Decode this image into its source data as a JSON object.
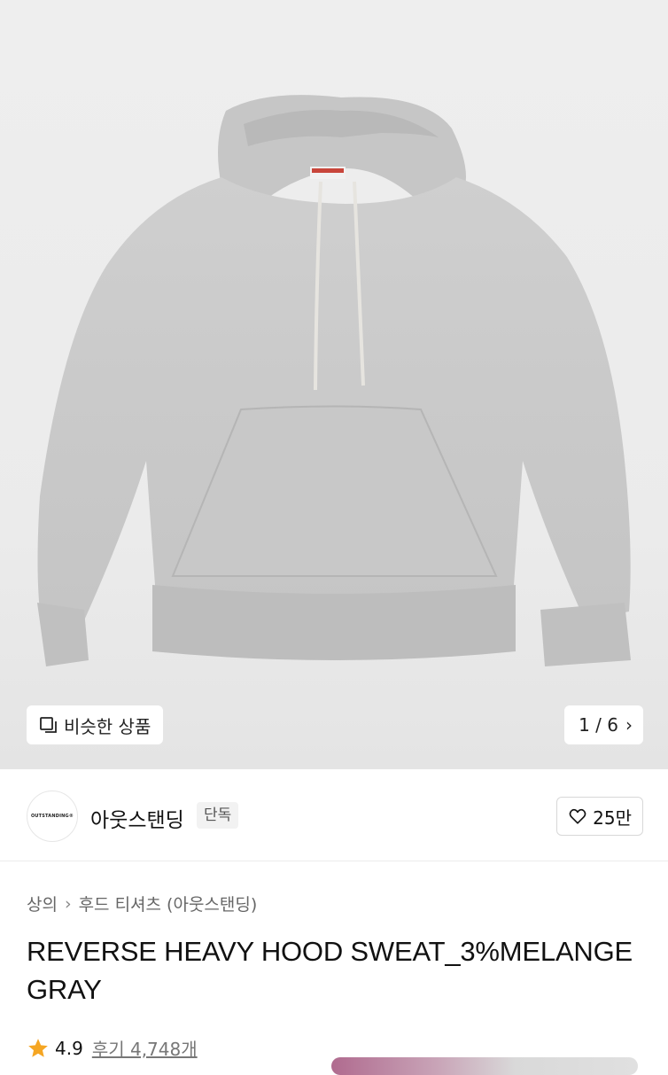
{
  "gallery": {
    "similar_label": "비슷한 상품",
    "counter": "1 / 6",
    "image_name": "gray-hoodie-product-image"
  },
  "brand": {
    "logo_text": "OUTSTANDING®",
    "name": "아웃스탠딩",
    "tag": "단독",
    "like_count": "25만"
  },
  "breadcrumb": {
    "category": "상의",
    "subcategory": "후드 티셔츠 (아웃스탠딩)"
  },
  "product": {
    "title": "REVERSE HEAVY HOOD SWEAT_3%MELANGE GRAY"
  },
  "rating": {
    "score": "4.9",
    "reviews": "후기 4,748개"
  },
  "colors": {
    "star": "#f5a623",
    "hoodie": "#c9c9c9"
  }
}
